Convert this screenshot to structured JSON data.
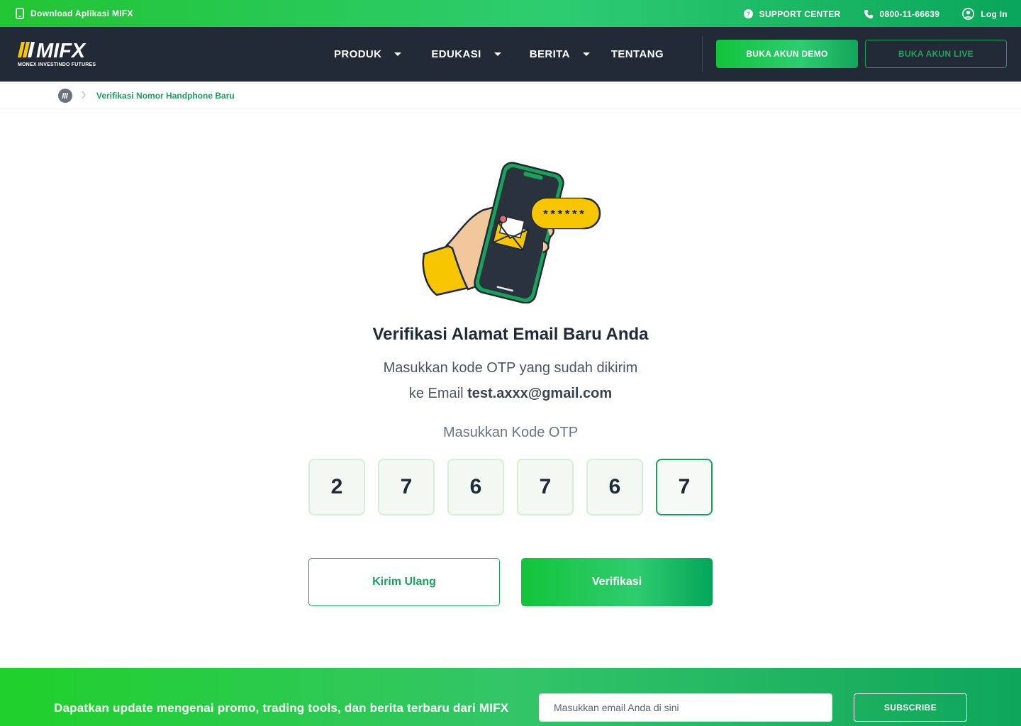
{
  "topbar": {
    "download_label": "Download Aplikasi MIFX",
    "support_label": "SUPPORT CENTER",
    "phone_label": "0800-11-66639",
    "login_label": "Log In"
  },
  "header": {
    "logo_text": "MIFX",
    "logo_subtext": "MONEX INVESTINDO FUTURES",
    "nav": [
      {
        "label": "PRODUK",
        "has_caret": true
      },
      {
        "label": "EDUKASI",
        "has_caret": true
      },
      {
        "label": "BERITA",
        "has_caret": true
      },
      {
        "label": "TENTANG",
        "has_caret": false
      }
    ],
    "demo_button": "BUKA AKUN DEMO",
    "live_button": "BUKA AKUN LIVE"
  },
  "breadcrumb": {
    "current": "Verifikasi Nomor Handphone Baru"
  },
  "illustration": {
    "badge_text": "******"
  },
  "main": {
    "title": "Verifikasi Alamat Email Baru Anda",
    "description_line1": "Masukkan kode OTP yang sudah dikirim",
    "description_prefix": "ke Email ",
    "email": "test.axxx@gmail.com",
    "otp_label": "Masukkan Kode OTP",
    "otp_digits": [
      "2",
      "7",
      "6",
      "7",
      "6",
      "7"
    ],
    "resend_button": "Kirim Ulang",
    "verify_button": "Verifikasi"
  },
  "newsletter": {
    "text": "Dapatkan update mengenai promo, trading tools, dan berita terbaru dari MIFX",
    "input_placeholder": "Masukkan email Anda di sini",
    "subscribe_button": "SUBSCRIBE"
  },
  "colors": {
    "brand_green": "#17a35a",
    "header_dark": "#212a36",
    "accent_yellow": "#f7c600"
  }
}
